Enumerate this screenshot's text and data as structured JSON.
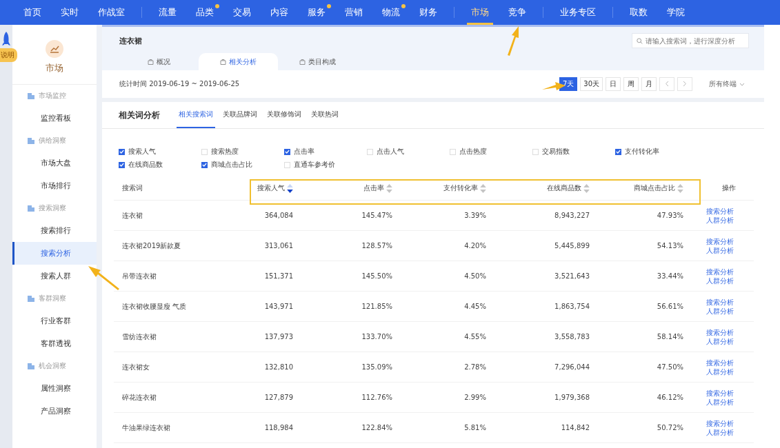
{
  "nav": [
    {
      "label": "首页",
      "dot": false,
      "divider_before": false,
      "selected": false
    },
    {
      "label": "实时",
      "dot": false,
      "divider_before": false,
      "selected": false
    },
    {
      "label": "作战室",
      "dot": false,
      "divider_before": false,
      "selected": false
    },
    {
      "label": "流量",
      "dot": false,
      "divider_before": true,
      "selected": false
    },
    {
      "label": "品类",
      "dot": true,
      "divider_before": false,
      "selected": false
    },
    {
      "label": "交易",
      "dot": false,
      "divider_before": false,
      "selected": false
    },
    {
      "label": "内容",
      "dot": false,
      "divider_before": false,
      "selected": false
    },
    {
      "label": "服务",
      "dot": true,
      "divider_before": false,
      "selected": false
    },
    {
      "label": "营销",
      "dot": false,
      "divider_before": false,
      "selected": false
    },
    {
      "label": "物流",
      "dot": true,
      "divider_before": false,
      "selected": false
    },
    {
      "label": "财务",
      "dot": false,
      "divider_before": false,
      "selected": false
    },
    {
      "label": "市场",
      "dot": false,
      "divider_before": true,
      "selected": true
    },
    {
      "label": "竞争",
      "dot": false,
      "divider_before": false,
      "selected": false
    },
    {
      "label": "业务专区",
      "dot": false,
      "divider_before": true,
      "selected": false
    },
    {
      "label": "取数",
      "dot": false,
      "divider_before": true,
      "selected": false
    },
    {
      "label": "学院",
      "dot": false,
      "divider_before": false,
      "selected": false
    }
  ],
  "help_badge": "说明",
  "sidebar": {
    "title": "市场",
    "groups": [
      {
        "label": "市场监控",
        "items": [
          {
            "label": "监控看板",
            "selected": false
          }
        ]
      },
      {
        "label": "供给洞察",
        "items": [
          {
            "label": "市场大盘",
            "selected": false
          },
          {
            "label": "市场排行",
            "selected": false
          }
        ]
      },
      {
        "label": "搜索洞察",
        "items": [
          {
            "label": "搜索排行",
            "selected": false
          },
          {
            "label": "搜索分析",
            "selected": true
          },
          {
            "label": "搜索人群",
            "selected": false
          }
        ]
      },
      {
        "label": "客群洞察",
        "items": [
          {
            "label": "行业客群",
            "selected": false
          },
          {
            "label": "客群透视",
            "selected": false
          }
        ]
      },
      {
        "label": "机会洞察",
        "items": [
          {
            "label": "属性洞察",
            "selected": false
          },
          {
            "label": "产品洞察",
            "selected": false
          }
        ]
      }
    ]
  },
  "header": {
    "title": "连衣裙",
    "search": {
      "placeholder": "请输入搜索词，进行深度分析"
    },
    "tabs": [
      {
        "label": "概况",
        "selected": false
      },
      {
        "label": "相关分析",
        "selected": true
      },
      {
        "label": "类目构成",
        "selected": false
      }
    ],
    "stat_time": "统计时间 2019-06-19 ~ 2019-06-25",
    "periods": [
      {
        "label": "7天",
        "selected": true
      },
      {
        "label": "30天",
        "selected": false
      },
      {
        "label": "日",
        "selected": false
      },
      {
        "label": "周",
        "selected": false
      },
      {
        "label": "月",
        "selected": false
      }
    ],
    "terminal": "所有终端"
  },
  "analysis": {
    "title": "相关词分析",
    "tabs": [
      {
        "label": "相关搜索词",
        "selected": true
      },
      {
        "label": "关联品牌词",
        "selected": false
      },
      {
        "label": "关联修饰词",
        "selected": false
      },
      {
        "label": "关联热词",
        "selected": false
      }
    ],
    "metrics": [
      {
        "label": "搜索人气",
        "checked": true
      },
      {
        "label": "搜索热度",
        "checked": false
      },
      {
        "label": "点击率",
        "checked": true
      },
      {
        "label": "点击人气",
        "checked": false
      },
      {
        "label": "点击热度",
        "checked": false
      },
      {
        "label": "交易指数",
        "checked": false
      },
      {
        "label": "支付转化率",
        "checked": true
      },
      {
        "label": "在线商品数",
        "checked": true
      },
      {
        "label": "商城点击占比",
        "checked": true
      },
      {
        "label": "直通车参考价",
        "checked": false
      }
    ],
    "table": {
      "columns": [
        {
          "label": "搜索词"
        },
        {
          "label": "搜索人气",
          "sorted": true
        },
        {
          "label": "点击率",
          "sorted": false
        },
        {
          "label": "支付转化率",
          "sorted": false
        },
        {
          "label": "在线商品数",
          "sorted": false
        },
        {
          "label": "商城点击占比",
          "sorted": false
        },
        {
          "label": "操作"
        }
      ],
      "rows": [
        {
          "cells": [
            "连衣裙",
            "364,084",
            "145.47%",
            "3.39%",
            "8,943,227",
            "47.93%"
          ],
          "actions": [
            "搜索分析",
            "人群分析"
          ]
        },
        {
          "cells": [
            "连衣裙2019新款夏",
            "313,061",
            "128.57%",
            "4.20%",
            "5,445,899",
            "54.13%"
          ],
          "actions": [
            "搜索分析",
            "人群分析"
          ]
        },
        {
          "cells": [
            "吊带连衣裙",
            "151,371",
            "145.50%",
            "4.50%",
            "3,521,643",
            "33.44%"
          ],
          "actions": [
            "搜索分析",
            "人群分析"
          ]
        },
        {
          "cells": [
            "连衣裙收腰显瘦 气质",
            "143,971",
            "121.85%",
            "4.45%",
            "1,863,754",
            "56.61%"
          ],
          "actions": [
            "搜索分析",
            "人群分析"
          ]
        },
        {
          "cells": [
            "雪纺连衣裙",
            "137,973",
            "133.70%",
            "4.55%",
            "3,558,783",
            "58.14%"
          ],
          "actions": [
            "搜索分析",
            "人群分析"
          ]
        },
        {
          "cells": [
            "连衣裙女",
            "132,810",
            "135.09%",
            "2.78%",
            "7,296,044",
            "47.50%"
          ],
          "actions": [
            "搜索分析",
            "人群分析"
          ]
        },
        {
          "cells": [
            "碎花连衣裙",
            "127,879",
            "112.76%",
            "2.99%",
            "1,979,368",
            "46.12%"
          ],
          "actions": [
            "搜索分析",
            "人群分析"
          ]
        },
        {
          "cells": [
            "牛油果绿连衣裙",
            "118,984",
            "122.84%",
            "5.81%",
            "114,842",
            "50.72%"
          ],
          "actions": [
            "搜索分析",
            "人群分析"
          ]
        }
      ]
    }
  }
}
